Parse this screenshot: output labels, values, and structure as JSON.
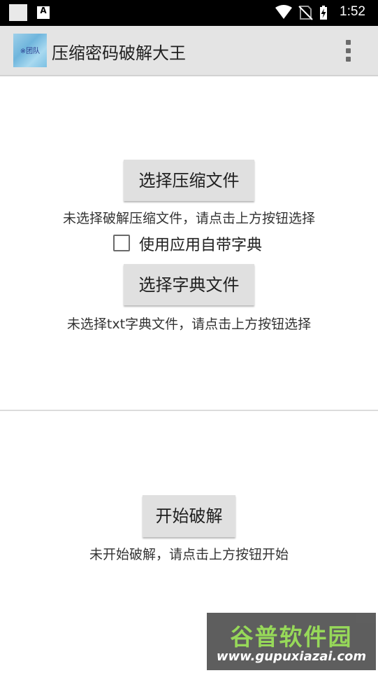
{
  "status_bar": {
    "time": "1:52",
    "notification_icon_letter": "A",
    "icons": [
      "wifi-icon",
      "no-sim-icon",
      "battery-charging-icon"
    ]
  },
  "app_bar": {
    "title": "压缩密码破解大王",
    "logo_text": "※团队",
    "menu_icon": "overflow-menu-icon"
  },
  "archive": {
    "button_label": "选择压缩文件",
    "status_text": "未选择破解压缩文件，请点击上方按钮选择"
  },
  "builtin_dict": {
    "checkbox_label": "使用应用自带字典",
    "checked": false
  },
  "dictionary": {
    "button_label": "选择字典文件",
    "status_text": "未选择txt字典文件，请点击上方按钮选择"
  },
  "crack": {
    "button_label": "开始破解",
    "status_text": "未开始破解，请点击上方按钮开始"
  },
  "watermark": {
    "brand": "谷普软件园",
    "url": "www.gupuxiazai.com"
  }
}
